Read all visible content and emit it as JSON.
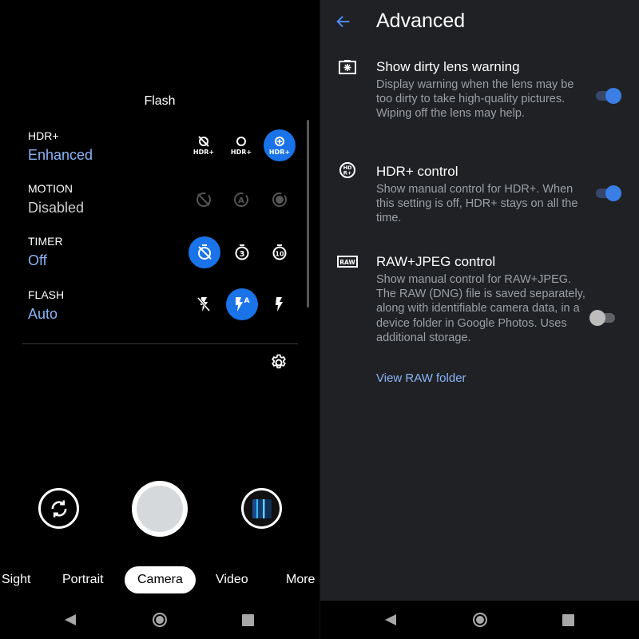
{
  "camera": {
    "settings_panel_title": "Flash",
    "rows": [
      {
        "label": "HDR+",
        "value": "Enhanced",
        "options": [
          "hdr-off-icon",
          "hdr-on-icon",
          "hdr-enhanced-icon"
        ],
        "selected": 2
      },
      {
        "label": "MOTION",
        "value": "Disabled",
        "options": [
          "motion-off-icon",
          "motion-auto-icon",
          "motion-on-icon"
        ],
        "selected": -1
      },
      {
        "label": "TIMER",
        "value": "Off",
        "options": [
          "timer-off-icon",
          "timer-3s-icon",
          "timer-10s-icon"
        ],
        "selected": 0
      },
      {
        "label": "FLASH",
        "value": "Auto",
        "options": [
          "flash-off-icon",
          "flash-auto-icon",
          "flash-on-icon"
        ],
        "selected": 1
      }
    ],
    "hdr_icon_text": "HDR+",
    "timer_3_text": "3",
    "timer_10_text": "10",
    "flash_auto_text": "A",
    "motion_auto_text": "A",
    "modes": [
      "Sight",
      "Portrait",
      "Camera",
      "Video",
      "More"
    ],
    "active_mode": "Camera",
    "accent_color": "#1a73e8",
    "value_color": "#8ab4f8"
  },
  "advanced": {
    "title": "Advanced",
    "settings": [
      {
        "icon": "dirty-lens-icon",
        "title": "Show dirty lens warning",
        "description": "Display warning when the lens may be too dirty to take high-quality pictures. Wiping off the lens may help.",
        "enabled": true
      },
      {
        "icon": "hdr-control-icon",
        "title": "HDR+ control",
        "description": "Show manual control for HDR+. When this setting is off, HDR+ stays on all the time.",
        "enabled": true
      },
      {
        "icon": "raw-icon",
        "title": "RAW+JPEG control",
        "description": "Show manual control for RAW+JPEG. The RAW (DNG) file is saved separately, along with identifiable camera data, in a device folder in Google Photos. Uses additional storage.",
        "enabled": false
      }
    ],
    "hdr_icon_text_top": "HD",
    "hdr_icon_text_bottom": "R+",
    "raw_icon_text": "RAW",
    "view_raw_link": "View RAW folder"
  }
}
